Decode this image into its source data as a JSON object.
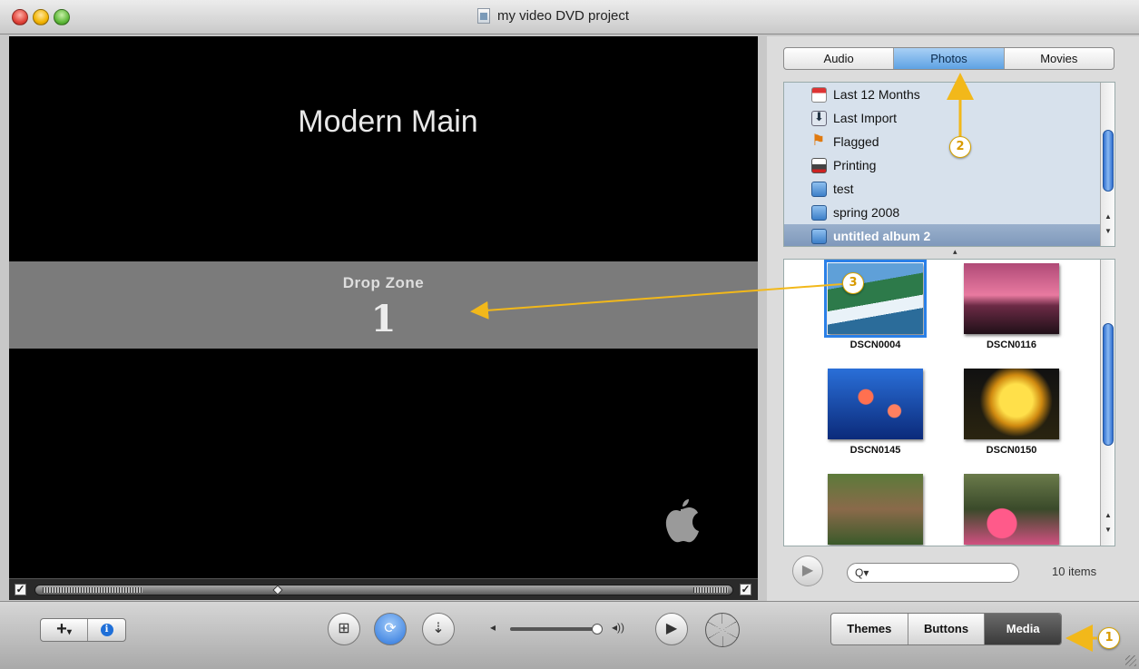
{
  "window": {
    "title": "my video DVD project"
  },
  "preview": {
    "menu_title": "Modern Main",
    "drop_zone_label": "Drop Zone",
    "drop_zone_number": "1"
  },
  "media_tabs": [
    {
      "label": "Audio",
      "selected": false
    },
    {
      "label": "Photos",
      "selected": true
    },
    {
      "label": "Movies",
      "selected": false
    }
  ],
  "source_list": [
    {
      "label": "Last 12 Months",
      "icon": "calendar-icon"
    },
    {
      "label": "Last Import",
      "icon": "import-icon"
    },
    {
      "label": "Flagged",
      "icon": "flag-icon"
    },
    {
      "label": "Printing",
      "icon": "printer-icon"
    },
    {
      "label": "test",
      "icon": "album-icon"
    },
    {
      "label": "spring 2008",
      "icon": "album-icon"
    },
    {
      "label": "untitled album 2",
      "icon": "album-icon",
      "selected": true
    }
  ],
  "photos": [
    {
      "name": "DSCN0004",
      "selected": true
    },
    {
      "name": "DSCN0116"
    },
    {
      "name": "DSCN0145"
    },
    {
      "name": "DSCN0150"
    },
    {
      "name": "",
      "caption_hidden": true
    },
    {
      "name": "",
      "caption_hidden": true
    }
  ],
  "search": {
    "placeholder": "Q▾"
  },
  "item_count": "10 items",
  "modes": [
    {
      "label": "Themes",
      "selected": false
    },
    {
      "label": "Buttons",
      "selected": false
    },
    {
      "label": "Media",
      "selected": true
    }
  ],
  "annotations": [
    "1",
    "2",
    "3"
  ],
  "colors": {
    "accent": "#2a80e8",
    "annotation": "#f2b81a"
  }
}
